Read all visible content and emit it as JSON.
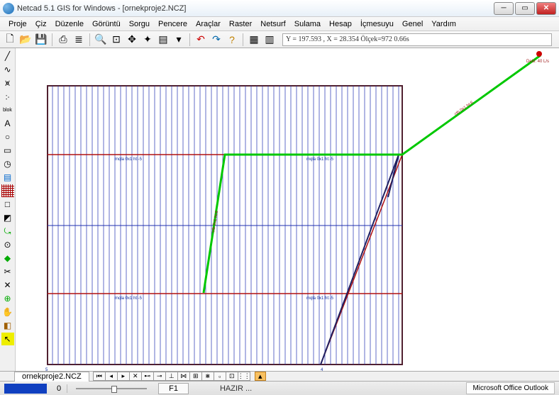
{
  "app": {
    "title": "Netcad 5.1 GIS for Windows - [ornekproje2.NCZ]"
  },
  "menu": {
    "items": [
      "Proje",
      "Çiz",
      "Düzenle",
      "Görüntü",
      "Sorgu",
      "Pencere",
      "Araçlar",
      "Raster",
      "Netsurf",
      "Sulama",
      "Hesap",
      "İçmesuyu",
      "Genel",
      "Yardım"
    ]
  },
  "toolbar": {
    "coord_text": "Y = 197.593 , X = 28.354  Ölçek=972   0.66s"
  },
  "tabs": {
    "doc": "ornekproje2.NCZ"
  },
  "statusbar": {
    "num": "0",
    "key": "F1",
    "status": "HAZIR ...",
    "outlook": "Microsoft Office Outlook"
  },
  "canvas": {
    "top_right_label": "Debi: 40 L/s",
    "axis_left": "5",
    "axis_right": "4",
    "label_mid_upper": "mqla 0x1 ht:-5",
    "label_mid_lower": "mqla 0x1 ht:-5",
    "label_left_upper": "mqla 0x1 ht:-5",
    "label_left_lower": "mqla 0x1 ht:-5",
    "label_vert_green": "ctb 0x1 ht:6",
    "label_diag_green": "ctb 0x1 ht:6"
  }
}
